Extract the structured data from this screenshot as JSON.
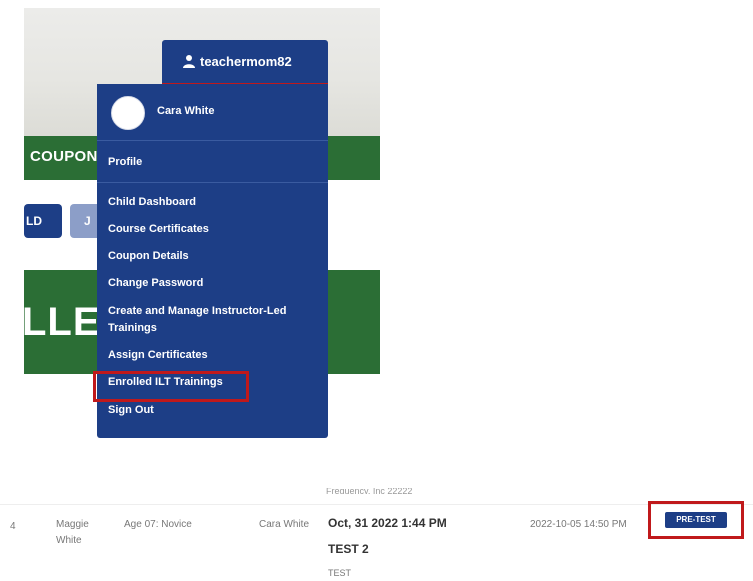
{
  "hero": {
    "band_label": "COUPON",
    "banner_label": "LLED"
  },
  "chips": {
    "child_label": "LD",
    "second_label": "J"
  },
  "user_menu": {
    "username": "teachermom82",
    "display_name": "Cara White",
    "items": [
      "Profile",
      "Child Dashboard",
      "Course Certificates",
      "Coupon Details",
      "Change Password",
      "Create and Manage Instructor-Led Trainings",
      "Assign Certificates",
      "Enrolled ILT Trainings",
      "Sign Out"
    ]
  },
  "table_row": {
    "index": "4",
    "student": "Maggie White",
    "age_group": "Age 07: Novice",
    "instructor": "Cara White",
    "session_date": "Oct, 31 2022 1:44 PM",
    "training_title": "TEST 2",
    "training_sub": "TEST",
    "created": "2022-10-05 14:50 PM",
    "action_label": "PRE-TEST",
    "clipped_text": "Frequency, Inc 22222"
  },
  "colors": {
    "navy": "#1d3e86",
    "green": "#2b6e35",
    "highlight_red": "#c0191b"
  },
  "icons": {
    "user": "user-icon",
    "avatar": "avatar-image"
  }
}
